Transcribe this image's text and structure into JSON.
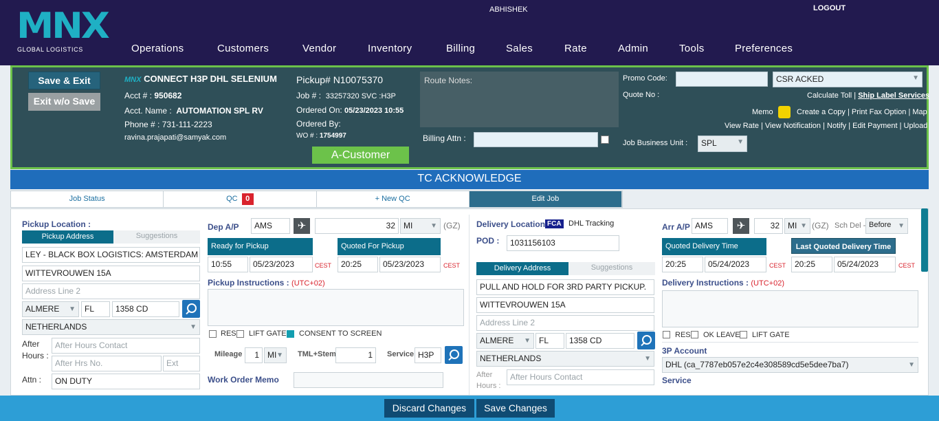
{
  "nav": {
    "logo": "MNX",
    "logo_sub": "GLOBAL LOGISTICS",
    "user": "ABHISHEK",
    "logout": "LOGOUT",
    "menu": [
      "Operations",
      "Customers",
      "Vendor",
      "Inventory",
      "Billing",
      "Sales",
      "Rate",
      "Admin",
      "Tools",
      "Preferences"
    ]
  },
  "header": {
    "save_exit": "Save & Exit",
    "exit_no_save": "Exit w/o Save",
    "mnx_small": "MNX",
    "company": "CONNECT H3P DHL SELENIUM",
    "acct_label": "Acct # :",
    "acct": "950682",
    "acct_name_label": "Acct. Name :",
    "acct_name": "AUTOMATION SPL RV",
    "phone_label": "Phone # :",
    "phone": "731-111-2223",
    "email": "ravina.prajapati@samyak.com",
    "pickup": "Pickup# N10075370",
    "job_label": "Job # :",
    "job": "33257320 SVC :",
    "job_svc": "H3P",
    "ordered_on_label": "Ordered On:",
    "ordered_on": "05/23/2023 10:55",
    "ordered_by_label": "Ordered By:",
    "wo_label": "WO # :",
    "wo": "1754997",
    "customer_btn": "A-Customer",
    "route_notes": "Route Notes:",
    "billing_attn": "Billing Attn :",
    "promo_label": "Promo Code:",
    "promo_value": "",
    "status_select": "CSR ACKED",
    "quote_label": "Quote No :",
    "calc_toll": "Calculate Toll",
    "ship_label": "Ship Label Services",
    "memo": "Memo",
    "links1": [
      "Create a Copy",
      "Print Fax Option",
      "Map"
    ],
    "links2": [
      "View Rate",
      "View Notification",
      "Notify",
      "Edit Payment",
      "Upload"
    ],
    "jbu_label": "Job Business Unit :",
    "jbu": "SPL"
  },
  "title": "TC ACKNOWLEDGE",
  "tabs": {
    "job_status": "Job Status",
    "qc": "QC",
    "qc_count": "0",
    "new_qc": "+ New QC",
    "edit_job": "Edit Job"
  },
  "pickup": {
    "location_label": "Pickup Location :",
    "address_tab": "Pickup Address",
    "suggestions": "Suggestions",
    "line1": "LEY - BLACK BOX LOGISTICS: AMSTERDAM",
    "line2": "WITTEVROUWEN 15A",
    "line3_ph": "Address Line 2",
    "city": "ALMERE",
    "state": "FL",
    "zip": "1358 CD",
    "country": "NETHERLANDS",
    "after_hours_label": "After Hours :",
    "after_contact_ph": "After Hours Contact",
    "after_no_ph": "After Hrs No.",
    "ext_ph": "Ext",
    "attn_label": "Attn :",
    "attn": "ON DUTY",
    "dep_label": "Dep A/P",
    "dep": "AMS",
    "dep_mi": "32",
    "dep_unit": "MI",
    "gz": "(GZ)",
    "ready_label": "Ready for Pickup",
    "ready_time": "10:55",
    "ready_date": "05/23/2023",
    "ready_tz": "CEST",
    "quoted_label": "Quoted For Pickup",
    "quoted_time": "20:25",
    "quoted_date": "05/23/2023",
    "quoted_tz": "CEST",
    "instr_label": "Pickup Instructions :",
    "instr_tz": "(UTC+02)",
    "res": "RES",
    "lift": "LIFT GATE",
    "consent": "CONSENT TO SCREEN",
    "mileage_label": "Mileage",
    "mileage": "1",
    "mileage_unit": "MI",
    "tml_label": "TML+Stem",
    "tml": "1",
    "service_label": "Service",
    "service": "H3P",
    "wo_memo": "Work Order Memo"
  },
  "delivery": {
    "location_label": "Delivery Location :",
    "fca": "FCA",
    "dhl_tracking": "DHL Tracking",
    "pod_label": "POD :",
    "pod": "1031156103",
    "address_tab": "Delivery Address",
    "suggestions": "Suggestions",
    "line1": "PULL AND HOLD FOR 3RD PARTY PICKUP.",
    "line2": "WITTEVROUWEN 15A",
    "line3_ph": "Address Line 2",
    "city": "ALMERE",
    "state": "FL",
    "zip": "1358 CD",
    "country": "NETHERLANDS",
    "after_label": "After Hours :",
    "after_contact_ph": "After Hours Contact",
    "arr_label": "Arr A/P",
    "arr": "AMS",
    "arr_mi": "32",
    "arr_unit": "MI",
    "gz": "(GZ)",
    "sch_label": "Sch Del -",
    "sch": "Before",
    "qdt_label": "Quoted Delivery Time",
    "qdt_time": "20:25",
    "qdt_date": "05/24/2023",
    "qdt_tz": "CEST",
    "lqdt_label": "Last Quoted Delivery Time",
    "lqdt_time": "20:25",
    "lqdt_date": "05/24/2023",
    "lqdt_tz": "CEST",
    "instr_label": "Delivery Instructions :",
    "instr_tz": "(UTC+02)",
    "res": "RES",
    "ok_leave": "OK LEAVE",
    "lift": "LIFT GATE",
    "acct3p_label": "3P Account",
    "acct3p": "DHL (ca_7787eb057e2c4e308589cd5e5dee7ba7)",
    "service_label": "Service"
  },
  "footer": {
    "discard": "Discard Changes",
    "save": "Save Changes"
  }
}
